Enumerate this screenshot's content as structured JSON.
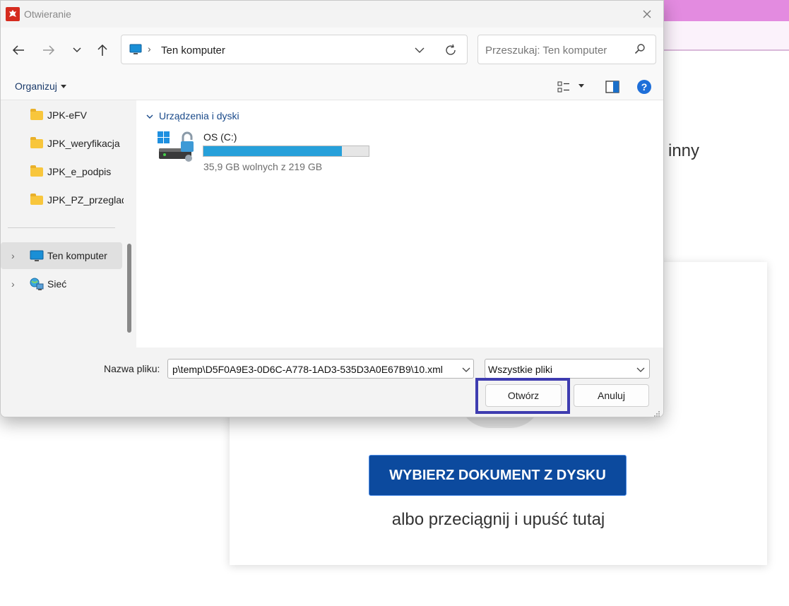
{
  "background": {
    "text_inny": "inny",
    "upload_button": "WYBIERZ DOKUMENT Z DYSKU",
    "drop_text": "albo przeciągnij i upuść tutaj"
  },
  "dialog": {
    "title": "Otwieranie",
    "address": {
      "location": "Ten komputer"
    },
    "search": {
      "placeholder": "Przeszukaj: Ten komputer"
    },
    "toolbar": {
      "organize_label": "Organizuj"
    },
    "sidebar": {
      "folders": [
        {
          "label": "JPK-eFV"
        },
        {
          "label": "JPK_weryfikacja"
        },
        {
          "label": "JPK_e_podpis"
        },
        {
          "label": "JPK_PZ_przeglad"
        }
      ],
      "locations": [
        {
          "label": "Ten komputer",
          "selected": true
        },
        {
          "label": "Sieć",
          "selected": false
        }
      ]
    },
    "main": {
      "group_header": "Urządzenia i dyski",
      "drive": {
        "name": "OS (C:)",
        "free_text": "35,9 GB wolnych z 219 GB",
        "used_fraction": 0.836
      }
    },
    "bottom": {
      "filename_label": "Nazwa pliku:",
      "filename_value": "p\\temp\\D5F0A9E3-0D6C-A778-1AD3-535D3A0E67B9\\10.xml",
      "filter_value": "Wszystkie pliki",
      "open_label": "Otwórz",
      "cancel_label": "Anuluj"
    }
  },
  "colors": {
    "accent": "#26a0da",
    "highlight": "#3e3cb0",
    "brand_button": "#0c4a9e",
    "top_bar": "#e38be0"
  }
}
